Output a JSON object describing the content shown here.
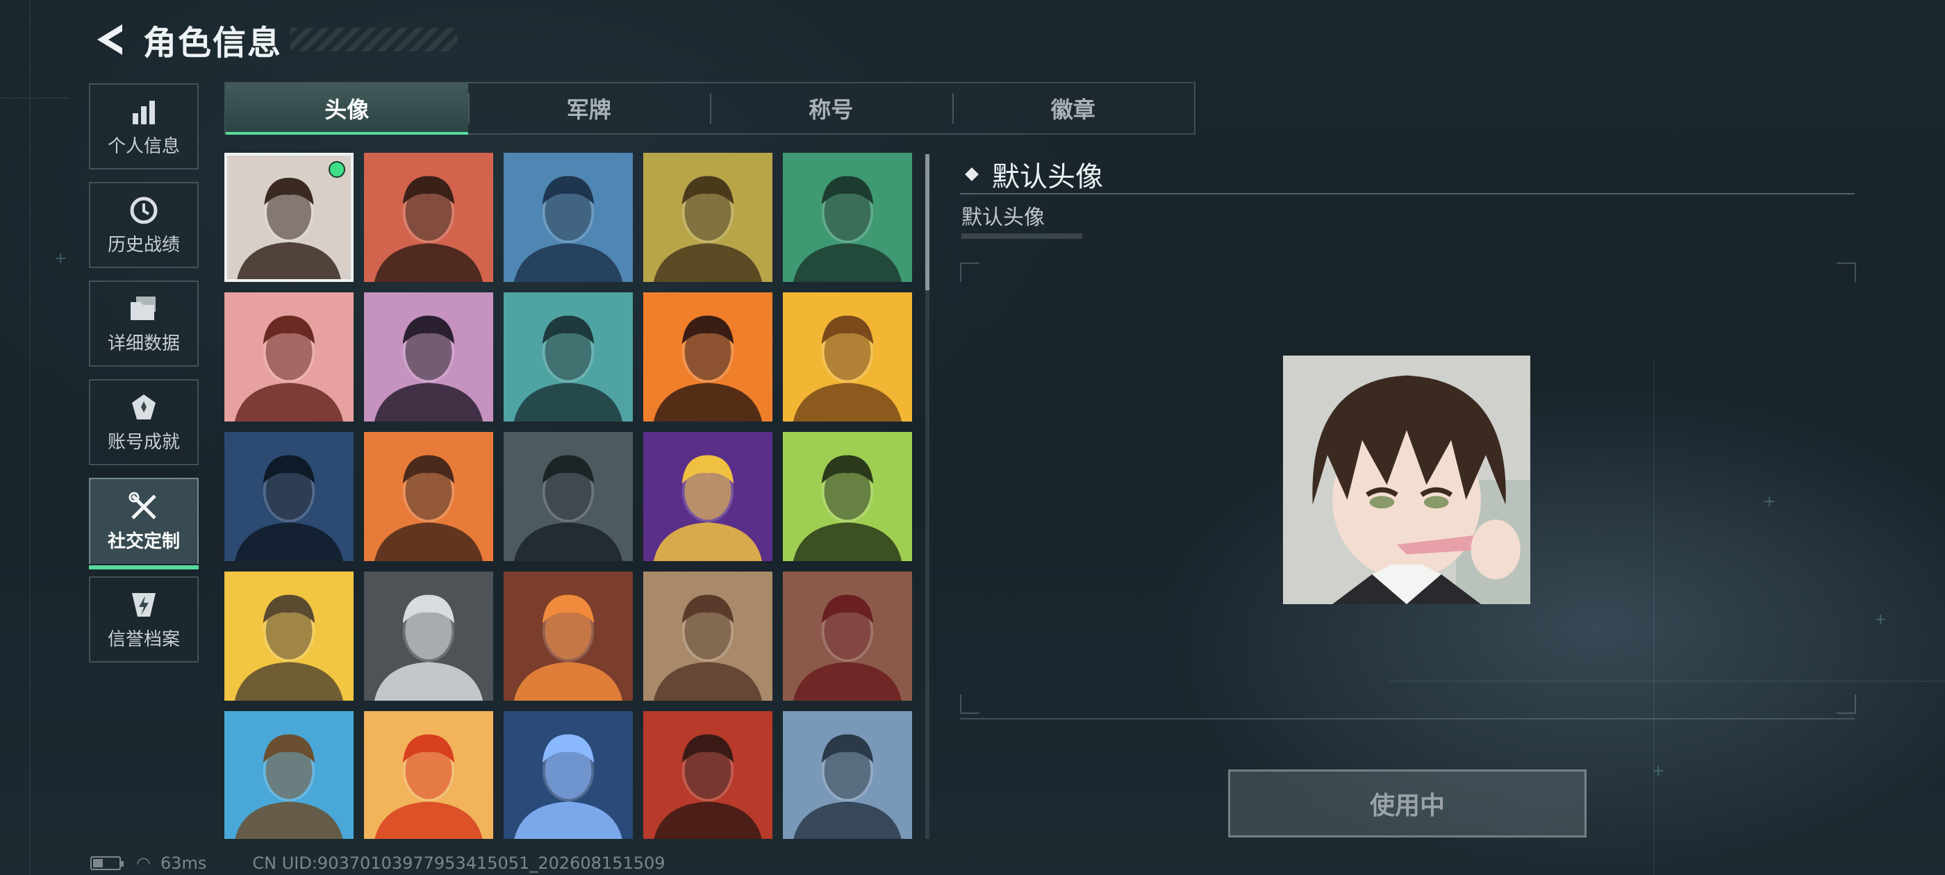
{
  "header": {
    "title": "角色信息"
  },
  "nav": [
    {
      "label": "个人信息",
      "icon": "bar-chart-icon",
      "active": false
    },
    {
      "label": "历史战绩",
      "icon": "history-clock-icon",
      "active": false
    },
    {
      "label": "详细数据",
      "icon": "folder-icon",
      "active": false
    },
    {
      "label": "账号成就",
      "icon": "achievement-icon",
      "active": false
    },
    {
      "label": "社交定制",
      "icon": "tools-icon",
      "active": true
    },
    {
      "label": "信誉档案",
      "icon": "shield-lightning-icon",
      "active": false
    }
  ],
  "tabs": [
    {
      "label": "头像",
      "active": true
    },
    {
      "label": "军牌",
      "active": false
    },
    {
      "label": "称号",
      "active": false
    },
    {
      "label": "徽章",
      "active": false
    }
  ],
  "avatars": [
    {
      "id": "anime-boy",
      "bg": "#d8d0c8",
      "fg": "#3a2a22",
      "selected": true,
      "in_use": true
    },
    {
      "id": "cap-soldier",
      "bg": "#d2644e",
      "fg": "#3b2018"
    },
    {
      "id": "pilot-woman",
      "bg": "#4f86b3",
      "fg": "#1e3650"
    },
    {
      "id": "bald-headset",
      "bg": "#b8a54a",
      "fg": "#4a3a1c"
    },
    {
      "id": "green-headset",
      "bg": "#3f9a73",
      "fg": "#1d3c30"
    },
    {
      "id": "red-helmet",
      "bg": "#e7a1a0",
      "fg": "#6a2a22"
    },
    {
      "id": "white-hair-girl",
      "bg": "#c692c0",
      "fg": "#2a2030"
    },
    {
      "id": "teal-glasses",
      "bg": "#4fa3a3",
      "fg": "#1f3a3d"
    },
    {
      "id": "masked-orange",
      "bg": "#f07f2c",
      "fg": "#3a1e14"
    },
    {
      "id": "triangle-emblem",
      "bg": "#f2b634",
      "fg": "#7a4a1a"
    },
    {
      "id": "night-soldier",
      "bg": "#2c4a72",
      "fg": "#0f1a28"
    },
    {
      "id": "drone-operator",
      "bg": "#e87b3a",
      "fg": "#4a2a1a"
    },
    {
      "id": "sniper-scope",
      "bg": "#4d5a5e",
      "fg": "#1c2428"
    },
    {
      "id": "space-book",
      "bg": "#5a2f8a",
      "fg": "#f0c040"
    },
    {
      "id": "exit-door",
      "bg": "#9fcf52",
      "fg": "#2a3a1a"
    },
    {
      "id": "robot-noodles",
      "bg": "#f2c542",
      "fg": "#5a4a30"
    },
    {
      "id": "crystal-hand",
      "bg": "#4d5357",
      "fg": "#d8dcdf"
    },
    {
      "id": "feather",
      "bg": "#7b3d2c",
      "fg": "#f08a3c"
    },
    {
      "id": "wrecked-truck",
      "bg": "#a88a6a",
      "fg": "#5a3a2a"
    },
    {
      "id": "scales-shield",
      "bg": "#8c5a4a",
      "fg": "#6a2020"
    },
    {
      "id": "party-man",
      "bg": "#4aa8d8",
      "fg": "#6a5030"
    },
    {
      "id": "fries-mascot",
      "bg": "#f2b35a",
      "fg": "#d84020"
    },
    {
      "id": "lightning-tube",
      "bg": "#2a4a7a",
      "fg": "#8ab8ff"
    },
    {
      "id": "red-hair-woman",
      "bg": "#b83a2a",
      "fg": "#3a1a14"
    },
    {
      "id": "mountain-view",
      "bg": "#7a98b8",
      "fg": "#2a3a48"
    }
  ],
  "detail": {
    "title": "默认头像",
    "subtitle": "默认头像",
    "button_label": "使用中"
  },
  "status": {
    "ping": "63ms",
    "uid": "CN UID:90370103977953415051_202608151509"
  }
}
